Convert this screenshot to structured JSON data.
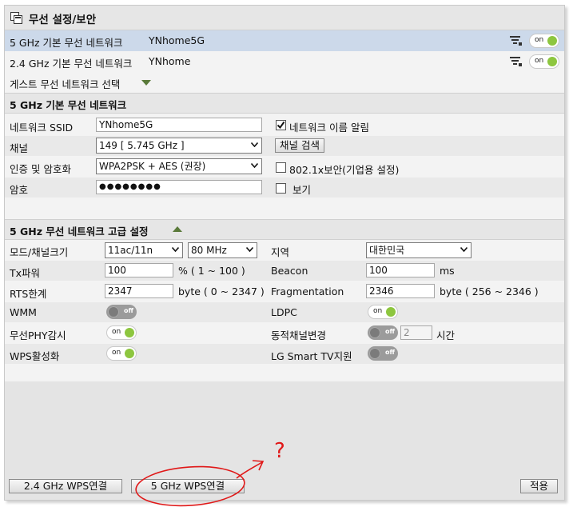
{
  "title": "무선 설정/보안",
  "networks": [
    {
      "label": "5 GHz 기본 무선 네트워크",
      "ssid": "YNhome5G",
      "toggle": "on"
    },
    {
      "label": "2.4 GHz 기본 무선 네트워크",
      "ssid": "YNhome",
      "toggle": "on"
    }
  ],
  "guest_label": "게스트 무선 네트워크 선택",
  "basic": {
    "header": "5 GHz 기본 무선 네트워크",
    "ssid_label": "네트워크 SSID",
    "ssid_value": "YNhome5G",
    "broadcast_label": "네트워크 이름 알림",
    "channel_label": "채널",
    "channel_value": "149 [ 5.745 GHz ]",
    "channel_search": "채널 검색",
    "auth_label": "인증 및 암호화",
    "auth_value": "WPA2PSK + AES (권장)",
    "dot1x_label": "802.1x보안(기업용 설정)",
    "pw_label": "암호",
    "pw_value": "●●●●●●●●",
    "show_label": "보기"
  },
  "advanced": {
    "header": "5 GHz 무선 네트워크 고급 설정",
    "mode_label": "모드/채널크기",
    "mode_value": "11ac/11n",
    "width_value": "80 MHz",
    "region_label": "지역",
    "region_value": "대한민국",
    "txpower_label": "Tx파워",
    "txpower_value": "100",
    "txpower_unit": "% ( 1 ~ 100 )",
    "beacon_label": "Beacon",
    "beacon_value": "100",
    "beacon_unit": "ms",
    "rts_label": "RTS한계",
    "rts_value": "2347",
    "rts_unit": "byte ( 0 ~ 2347 )",
    "frag_label": "Fragmentation",
    "frag_value": "2346",
    "frag_unit": "byte ( 256 ~ 2346 )",
    "wmm_label": "WMM",
    "wmm_state": "off",
    "ldpc_label": "LDPC",
    "ldpc_state": "on",
    "phy_label": "무선PHY감시",
    "phy_state": "on",
    "dyn_label": "동적채널변경",
    "dyn_state": "off",
    "dyn_value": "2",
    "dyn_unit": "시간",
    "wps_label": "WPS활성화",
    "wps_state": "on",
    "lgtv_label": "LG Smart TV지원",
    "lgtv_state": "off"
  },
  "footer": {
    "wps24": "2.4 GHz WPS연결",
    "wps5": "5 GHz WPS연결",
    "apply": "적용"
  },
  "annotation": {
    "question": "?",
    "color": "#e01818"
  }
}
